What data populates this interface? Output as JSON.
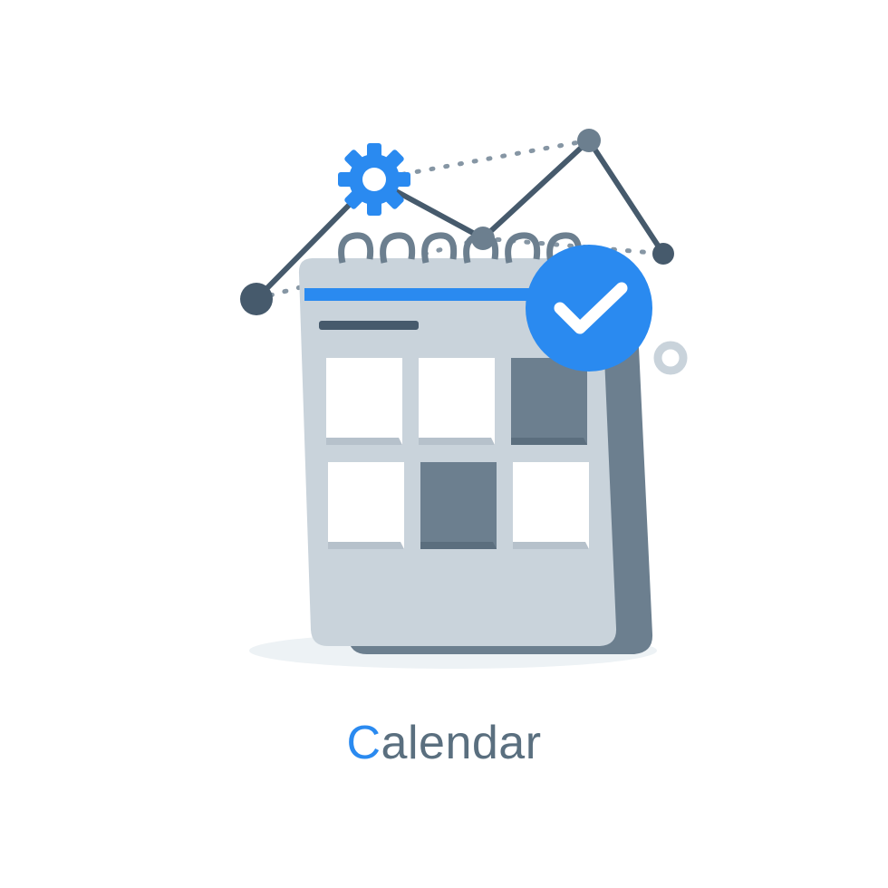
{
  "caption": {
    "accent_letter": "C",
    "rest": "alendar"
  },
  "colors": {
    "accent": "#2a8af0",
    "text": "#5a6f7f",
    "dark": "#465a6c",
    "mid": "#6c7f8f",
    "light": "#c9d3db",
    "lighter": "#d8e0e6",
    "white": "#ffffff",
    "shadow": "#e8eef3"
  },
  "icons": {
    "main": "calendar-icon",
    "badge": "checkmark-icon",
    "gear": "gear-icon",
    "network": "node-network"
  }
}
